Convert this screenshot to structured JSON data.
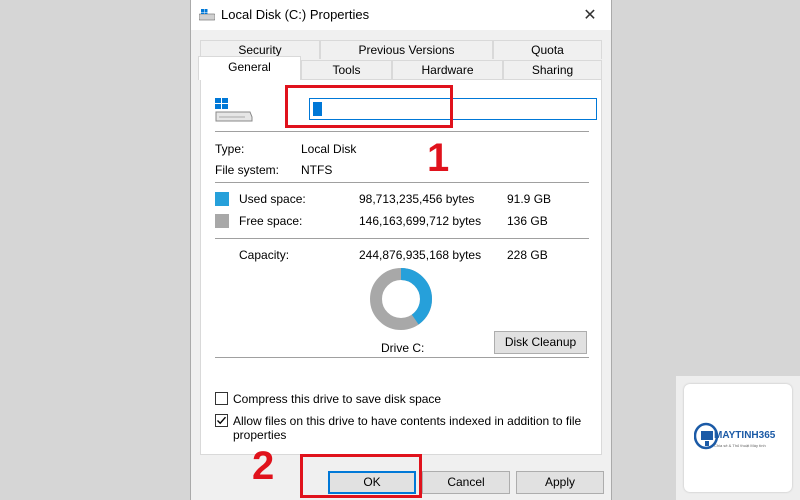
{
  "window": {
    "title": "Local Disk (C:) Properties",
    "close_glyph": "✕"
  },
  "tabs": {
    "row1": [
      {
        "label": "Security"
      },
      {
        "label": "Previous Versions"
      },
      {
        "label": "Quota"
      }
    ],
    "row2": [
      {
        "label": "General",
        "active": true
      },
      {
        "label": "Tools"
      },
      {
        "label": "Hardware"
      },
      {
        "label": "Sharing"
      }
    ]
  },
  "general": {
    "name_value": "",
    "type_label": "Type:",
    "type_value": "Local Disk",
    "fs_label": "File system:",
    "fs_value": "NTFS",
    "used": {
      "label": "Used space:",
      "bytes": "98,713,235,456 bytes",
      "size": "91.9 GB",
      "color": "#26a0da"
    },
    "free": {
      "label": "Free space:",
      "bytes": "146,163,699,712 bytes",
      "size": "136 GB",
      "color": "#a8a8a8"
    },
    "capacity": {
      "label": "Capacity:",
      "bytes": "244,876,935,168 bytes",
      "size": "228 GB"
    },
    "used_fraction": 0.403,
    "drive_label": "Drive C:",
    "cleanup_label": "Disk Cleanup",
    "compress_label": "Compress this drive to save disk space",
    "compress_checked": false,
    "index_label_line1": "Allow files on this drive to have contents indexed in addition to file",
    "index_label_line2": "properties",
    "index_checked": true
  },
  "footer": {
    "ok_label": "OK",
    "cancel_label": "Cancel",
    "apply_label": "Apply"
  },
  "annotations": {
    "step1": "1",
    "step2": "2",
    "color": "#e0121c"
  },
  "watermark": {
    "brand": "MAYTINH365",
    "tagline": "Chia sẻ & Thủ thuật Máy tính"
  }
}
